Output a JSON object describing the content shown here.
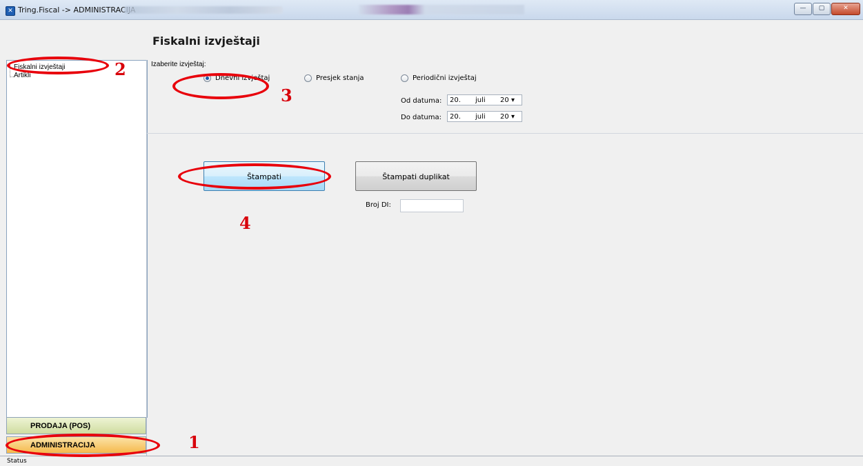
{
  "window": {
    "title": "Tring.Fiscal -> ADMINISTRACIJA",
    "controls": {
      "minimize": "—",
      "maximize": "▢",
      "close": "✕"
    }
  },
  "page": {
    "title": "Fiskalni izvještaji"
  },
  "sidebar": {
    "tree": [
      "Fiskalni izvještaji",
      "Artikli"
    ],
    "nav": {
      "pos": "PRODAJA (POS)",
      "admin": "ADMINISTRACIJA"
    }
  },
  "report": {
    "group_label": "Izaberite izvještaj:",
    "options": [
      "Dnevni izvještaj",
      "Presjek stanja",
      "Periodični izvještaj"
    ],
    "selected": "Dnevni izvještaj",
    "from_label": "Od datuma:",
    "to_label": "Do datuma:",
    "from_date": {
      "day": "20.",
      "month": "juli",
      "year": "20"
    },
    "to_date": {
      "day": "20.",
      "month": "juli",
      "year": "20"
    },
    "dropdown_icon": "▾"
  },
  "actions": {
    "print": "Štampati",
    "print_duplicate": "Štampati duplikat",
    "broj_di_label": "Broj DI:",
    "broj_di_value": ""
  },
  "status": {
    "text": "Status"
  },
  "annotations": [
    "1",
    "2",
    "3",
    "4"
  ],
  "colors": {
    "annotation": "#e8000b",
    "admin_nav": "#f5b94d",
    "pos_nav": "#cfdca0",
    "accent": "#1d5ba8"
  }
}
